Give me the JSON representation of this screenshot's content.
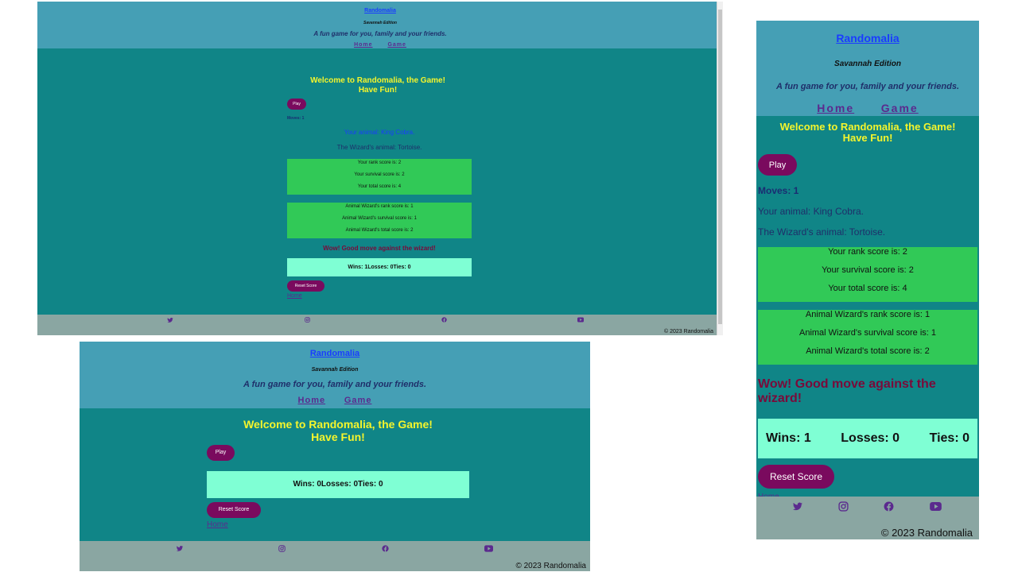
{
  "site": {
    "title": "Randomalia",
    "edition": "Savannah Edition",
    "tagline": "A fun game for you, family and your friends.",
    "nav": [
      "Home",
      "Game"
    ],
    "welcome_line1": "Welcome to Randomalia, the Game!",
    "welcome_line2": "Have Fun!",
    "play_label": "Play",
    "reset_label": "Reset Score",
    "home_link": "Home",
    "copyright": "© 2023 Randomalia",
    "social_icons": [
      "twitter-icon",
      "instagram-icon",
      "facebook-icon",
      "youtube-icon"
    ]
  },
  "game": {
    "moves": "Moves: 1",
    "your_animal": "Your animal: King Cobra.",
    "wizard_animal": "The Wizard's animal: Tortoise.",
    "player_scores": [
      "Your rank score is: 2",
      "Your survival score is: 2",
      "Your total score is: 4"
    ],
    "wizard_scores": [
      "Animal Wizard's rank score is: 1",
      "Animal Wizard's survival score is: 1",
      "Animal Wizard's total score is: 2"
    ],
    "result": "Wow! Good move against the wizard!",
    "tally_compact": "Wins: 1Losses: 0Ties: 0",
    "wins": "Wins: 1",
    "losses": "Losses: 0",
    "ties": "Ties: 0"
  },
  "initial": {
    "tally_compact": "Wins: 0Losses: 0Ties: 0"
  },
  "colors": {
    "header": "#459fb5",
    "body": "#108587",
    "score_box": "#31c957",
    "tally_box": "#7fffd4",
    "button": "#7a0a5e",
    "footer": "#8aa6a2",
    "welcome_text": "#f5f52c"
  }
}
